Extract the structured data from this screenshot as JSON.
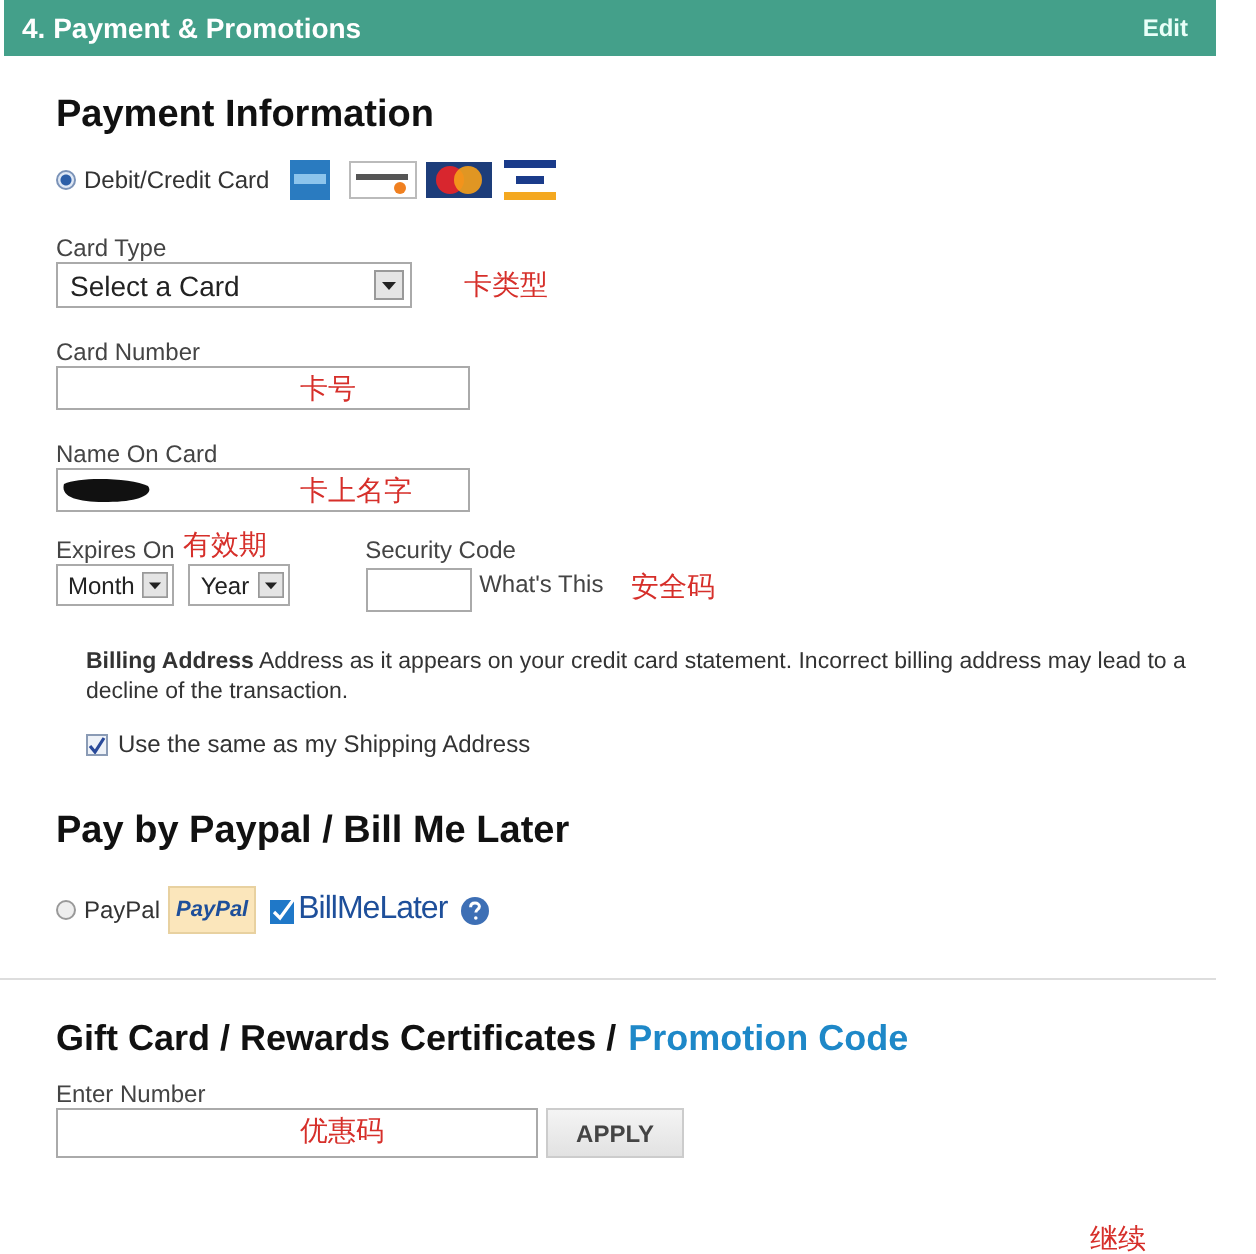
{
  "header": {
    "title": "4. Payment & Promotions",
    "action": "Edit"
  },
  "payment": {
    "title": "Payment Information",
    "method": {
      "label": "Debit/Credit Card",
      "selected": true
    },
    "card_type": {
      "label": "Card Type",
      "value": "Select a Card",
      "note": "卡类型"
    },
    "card_number": {
      "label": "Card Number",
      "note": "卡号"
    },
    "name_on_card": {
      "label": "Name On Card",
      "redacted": true,
      "note": "卡上名字"
    },
    "expires": {
      "label": "Expires On",
      "note": "有效期",
      "month": "Month",
      "year": "Year"
    },
    "security": {
      "label": "Security Code",
      "link": "What's This",
      "note": "安全码"
    },
    "billing": {
      "text": "**Billing Address** Address as it appears on your credit card statement. Incorrect billing address may lead to a decline of the transaction.",
      "same_as_shipping": {
        "label": "Use the same as my Shipping Address",
        "checked": true
      }
    }
  },
  "paypal": {
    "title": "Pay by Paypal / Bill Me Later",
    "option": {
      "label": "PayPal",
      "selected": false
    },
    "paypal_logo": "PayPal",
    "bml_logo": "BillMeLater"
  },
  "gift": {
    "title": "Gift Card / Rewards Certificates /",
    "link": "Promotion Code",
    "label": "Enter Number",
    "note": "优惠码",
    "button": "APPLY"
  },
  "continue_note": "继续"
}
